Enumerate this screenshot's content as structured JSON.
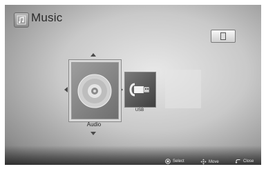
{
  "header": {
    "title": "Music"
  },
  "devices": [
    {
      "label": "Audio",
      "icon": "disc-icon",
      "selected": true
    },
    {
      "label": "USB",
      "icon": "usb-plug-icon",
      "selected": false
    }
  ],
  "footer": {
    "select_label": "Select",
    "move_label": "Move",
    "close_label": "Close"
  },
  "icons": {
    "title": "music-note-icon",
    "top_right": "sd-card-icon"
  }
}
